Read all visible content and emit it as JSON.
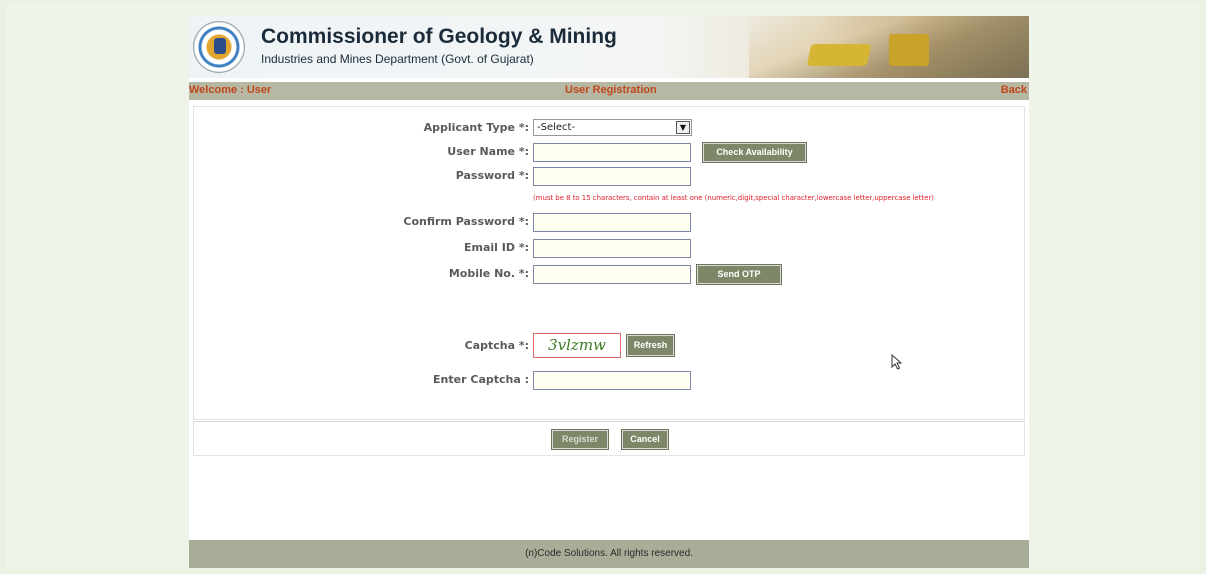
{
  "header": {
    "title": "Commissioner of Geology & Mining",
    "subtitle": "Industries and Mines Department (Govt. of Gujarat)"
  },
  "navbar": {
    "welcome": "Welcome : User",
    "page_title": "User Registration",
    "back": "Back"
  },
  "form": {
    "applicant_type": {
      "label": "Applicant Type *:",
      "selected": "-Select-"
    },
    "user_name": {
      "label": "User Name *:",
      "value": ""
    },
    "check_availability": "Check Availability",
    "password": {
      "label": "Password *:",
      "value": ""
    },
    "password_hint": "(must be 8 to 15 characters, contain at least one (numeric,digit,special character,lowercase letter,uppercase letter)",
    "confirm_password": {
      "label": "Confirm Password *:",
      "value": ""
    },
    "email": {
      "label": "Email ID *:",
      "value": ""
    },
    "mobile": {
      "label": "Mobile No. *:",
      "value": ""
    },
    "send_otp": "Send OTP",
    "captcha": {
      "label": "Captcha *:",
      "text": "3vlzmw"
    },
    "refresh": "Refresh",
    "enter_captcha": {
      "label": "Enter Captcha :",
      "value": ""
    },
    "register": "Register",
    "cancel": "Cancel"
  },
  "footer": {
    "text": "(n)Code Solutions. All rights reserved."
  },
  "colors": {
    "nav_text": "#c0471a",
    "button_bg": "#7e8868",
    "hint_text": "#e0202a",
    "captcha_text": "#3c7a22"
  }
}
